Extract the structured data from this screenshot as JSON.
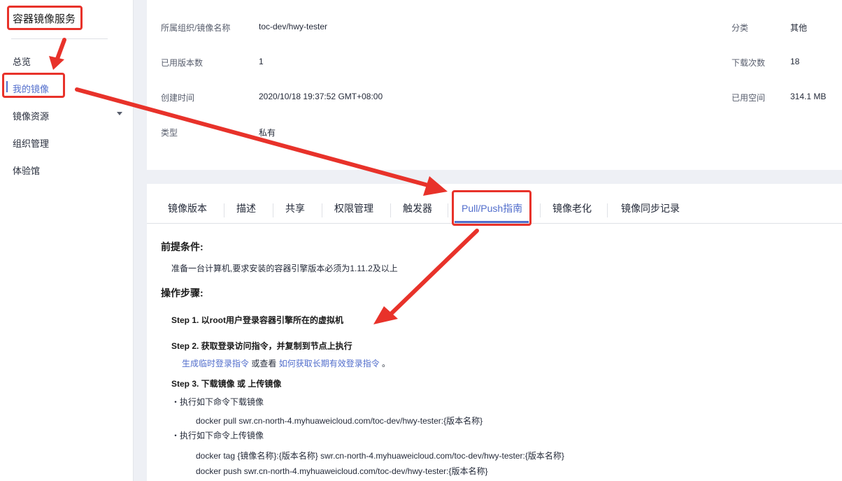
{
  "sidebar": {
    "title": "容器镜像服务",
    "items": [
      {
        "label": "总览"
      },
      {
        "label": "我的镜像"
      },
      {
        "label": "镜像资源"
      },
      {
        "label": "组织管理"
      },
      {
        "label": "体验馆"
      }
    ]
  },
  "info": {
    "org_label": "所属组织/镜像名称",
    "org_value": "toc-dev/hwy-tester",
    "versions_label": "已用版本数",
    "versions_value": "1",
    "created_label": "创建时间",
    "created_value": "2020/10/18 19:37:52 GMT+08:00",
    "type_label": "类型",
    "type_value": "私有",
    "category_label": "分类",
    "category_value": "其他",
    "downloads_label": "下载次数",
    "downloads_value": "18",
    "space_label": "已用空间",
    "space_value": "314.1 MB"
  },
  "tabs": [
    {
      "label": "镜像版本"
    },
    {
      "label": "描述"
    },
    {
      "label": "共享"
    },
    {
      "label": "权限管理"
    },
    {
      "label": "触发器"
    },
    {
      "label": "Pull/Push指南"
    },
    {
      "label": "镜像老化"
    },
    {
      "label": "镜像同步记录"
    }
  ],
  "guide": {
    "prereq_title": "前提条件:",
    "prereq_text": "准备一台计算机,要求安装的容器引擎版本必须为1.11.2及以上",
    "steps_title": "操作步骤:",
    "step1": "Step 1. 以root用户登录容器引擎所在的虚拟机",
    "step2": "Step 2. 获取登录访问指令，并复制到节点上执行",
    "step2_link1": "生成临时登录指令",
    "step2_mid": " 或查看 ",
    "step2_link2": "如何获取长期有效登录指令",
    "step2_end": " 。",
    "step3": "Step 3. 下载镜像 或 上传镜像",
    "pull_bullet": "・执行如下命令下载镜像",
    "pull_cmd": "docker pull swr.cn-north-4.myhuaweicloud.com/toc-dev/hwy-tester:{版本名称}",
    "push_bullet": "・执行如下命令上传镜像",
    "tag_cmd": "docker tag {镜像名称}:{版本名称} swr.cn-north-4.myhuaweicloud.com/toc-dev/hwy-tester:{版本名称}",
    "push_cmd": "docker push swr.cn-north-4.myhuaweicloud.com/toc-dev/hwy-tester:{版本名称}"
  },
  "colors": {
    "accent": "#526ecc",
    "annotation": "#e8322a"
  }
}
